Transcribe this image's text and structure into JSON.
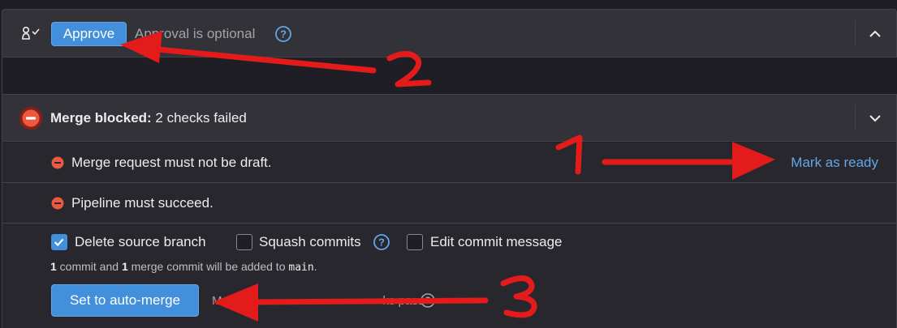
{
  "approval": {
    "approve_label": "Approve",
    "status_text": "Approval is optional",
    "help_icon": "question-circle-icon",
    "collapse_icon": "chevron-up-icon",
    "user_icon": "user-check-icon"
  },
  "merge": {
    "status_icon": "blocked-circle-icon",
    "title_bold": "Merge blocked:",
    "title_rest": " 2 checks failed",
    "expand_icon": "chevron-down-icon",
    "checks": [
      {
        "text": "Merge request must not be draft.",
        "action": "Mark as ready"
      },
      {
        "text": "Pipeline must succeed."
      }
    ]
  },
  "options": {
    "delete_source_branch": {
      "label": "Delete source branch",
      "checked": true
    },
    "squash_commits": {
      "label": "Squash commits",
      "checked": false
    },
    "edit_commit_message": {
      "label": "Edit commit message",
      "checked": false
    }
  },
  "commit_info": {
    "count_commits": "1",
    "text_1": " commit and ",
    "count_merge": "1",
    "text_2": " merge commit will be added to ",
    "branch": "main",
    "text_3": "."
  },
  "auto_merge": {
    "button_label": "Set to auto-merge",
    "note_start": "M",
    "note_end": "ks pass"
  },
  "annotations": {
    "label_1": "1",
    "label_2": "2",
    "label_3": "3",
    "color": "#e31b1b"
  },
  "colors": {
    "accent": "#428fdc",
    "danger": "#ec5941",
    "link": "#63a6e9",
    "panel": "#333238",
    "background": "#1f1e24"
  }
}
